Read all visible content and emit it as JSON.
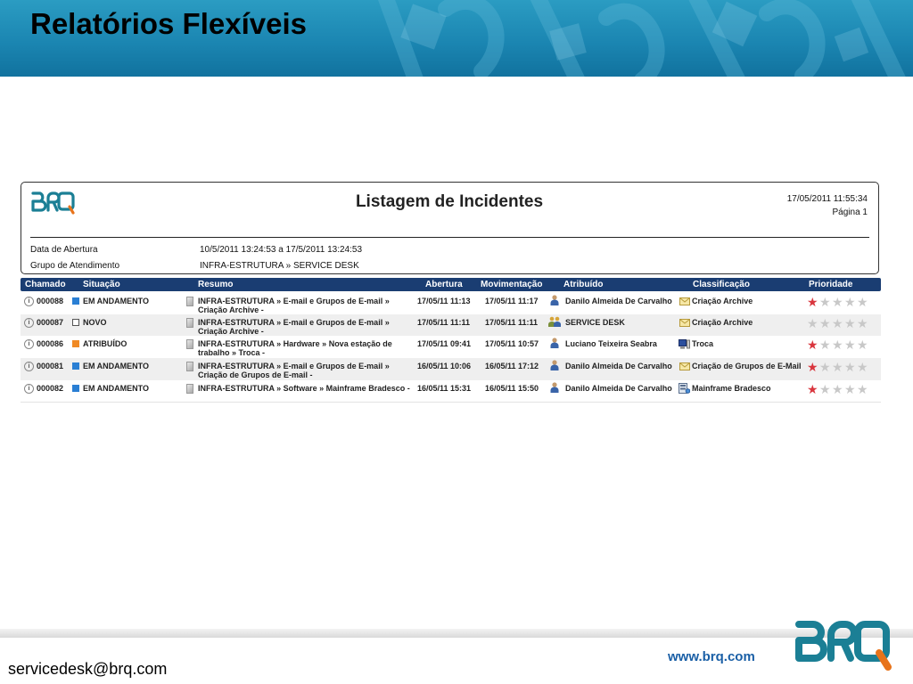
{
  "slide": {
    "title": "Relatórios Flexíveis",
    "footer_email": "servicedesk@brq.com",
    "footer_url": "www.brq.com"
  },
  "colors": {
    "banner": "#1b86b2",
    "header_navy": "#1a3d72",
    "brand_teal": "#1b7f95",
    "brand_orange": "#e8731a",
    "status_blue": "#2a7fd4",
    "status_orange": "#f08a24",
    "star_red": "#d9363e",
    "star_gray": "#c8c8c8"
  },
  "report": {
    "title": "Listagem de Incidentes",
    "date": "17/05/2011 11:55:34",
    "page": "Página 1",
    "filters": [
      {
        "label": "Data de Abertura",
        "value": "10/5/2011 13:24:53 a 17/5/2011 13:24:53"
      },
      {
        "label": "Grupo de Atendimento",
        "value": "INFRA-ESTRUTURA » SERVICE DESK"
      }
    ],
    "columns": [
      "Chamado",
      "Situação",
      "Resumo",
      "Abertura",
      "Movimentação",
      "Atribuído",
      "Classificação",
      "Prioridade"
    ],
    "rows": [
      {
        "id": "000088",
        "status": "EM ANDAMENTO",
        "status_icon": "status-blue-square-icon",
        "summary": "INFRA-ESTRUTURA » E-mail e Grupos de E-mail » Criação Archive -",
        "opened": "17/05/11 11:13",
        "moved": "17/05/11 11:17",
        "assignee": "Danilo Almeida De Carvalho",
        "assignee_icon": "user-icon",
        "classification": "Criação Archive",
        "classification_icon": "envelope-icon",
        "priority": 1
      },
      {
        "id": "000087",
        "status": "NOVO",
        "status_icon": "status-empty-square-icon",
        "summary": "INFRA-ESTRUTURA » E-mail e Grupos de E-mail » Criação Archive -",
        "opened": "17/05/11 11:11",
        "moved": "17/05/11 11:11",
        "assignee": "SERVICE DESK",
        "assignee_icon": "group-icon",
        "classification": "Criação Archive",
        "classification_icon": "envelope-icon",
        "priority": 0
      },
      {
        "id": "000086",
        "status": "ATRIBUÍDO",
        "status_icon": "status-orange-square-icon",
        "summary": "INFRA-ESTRUTURA » Hardware » Nova estação de trabalho » Troca -",
        "opened": "17/05/11 09:41",
        "moved": "17/05/11 10:57",
        "assignee": "Luciano Teixeira Seabra",
        "assignee_icon": "user-icon",
        "classification": "Troca",
        "classification_icon": "computer-icon",
        "priority": 1
      },
      {
        "id": "000081",
        "status": "EM ANDAMENTO",
        "status_icon": "status-blue-square-icon",
        "summary": "INFRA-ESTRUTURA » E-mail e Grupos de E-mail » Criação de Grupos de E-mail -",
        "opened": "16/05/11 10:06",
        "moved": "16/05/11 17:12",
        "assignee": "Danilo Almeida De Carvalho",
        "assignee_icon": "user-icon",
        "classification": "Criação de Grupos de E-Mail",
        "classification_icon": "envelope-icon",
        "priority": 1
      },
      {
        "id": "000082",
        "status": "EM ANDAMENTO",
        "status_icon": "status-blue-square-icon",
        "summary": "INFRA-ESTRUTURA » Software » Mainframe Bradesco -",
        "opened": "16/05/11 15:31",
        "moved": "16/05/11 15:50",
        "assignee": "Danilo Almeida De Carvalho",
        "assignee_icon": "user-icon",
        "classification": "Mainframe Bradesco",
        "classification_icon": "server-icon",
        "priority": 1
      }
    ]
  }
}
